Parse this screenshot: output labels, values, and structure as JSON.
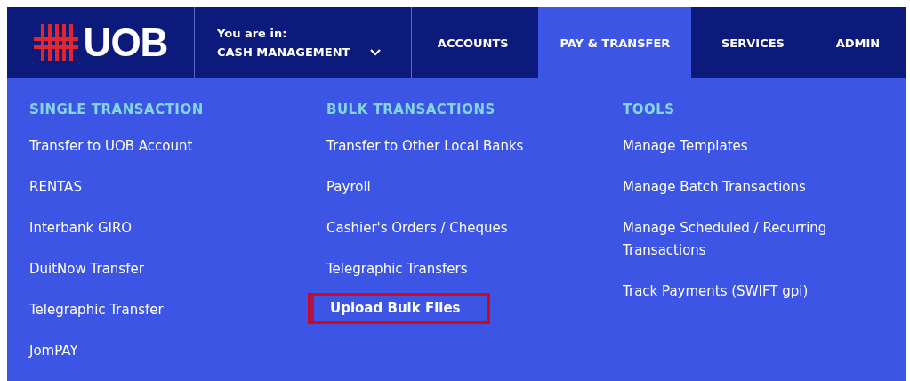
{
  "logo": {
    "text": "UOB"
  },
  "context": {
    "label": "You are in:",
    "value": "CASH MANAGEMENT"
  },
  "nav": [
    {
      "label": "ACCOUNTS",
      "selected": false
    },
    {
      "label": "PAY & TRANSFER",
      "selected": true
    },
    {
      "label": "SERVICES",
      "selected": false
    },
    {
      "label": "ADMIN",
      "selected": false
    }
  ],
  "menu_columns": [
    {
      "heading": "SINGLE TRANSACTION",
      "items": [
        {
          "label": "Transfer to UOB Account",
          "selected": false
        },
        {
          "label": "RENTAS",
          "selected": false
        },
        {
          "label": "Interbank GIRO",
          "selected": false
        },
        {
          "label": "DuitNow Transfer",
          "selected": false
        },
        {
          "label": "Telegraphic Transfer",
          "selected": false
        },
        {
          "label": "JomPAY",
          "selected": false
        }
      ]
    },
    {
      "heading": "BULK TRANSACTIONS",
      "items": [
        {
          "label": "Transfer to Other Local Banks",
          "selected": false
        },
        {
          "label": "Payroll",
          "selected": false
        },
        {
          "label": "Cashier's Orders / Cheques",
          "selected": false
        },
        {
          "label": "Telegraphic Transfers",
          "selected": false
        },
        {
          "label": "Upload Bulk Files",
          "selected": true
        }
      ]
    },
    {
      "heading": "TOOLS",
      "items": [
        {
          "label": "Manage Templates",
          "selected": false
        },
        {
          "label": "Manage Batch Transactions",
          "selected": false
        },
        {
          "label": "Manage Scheduled / Recurring Transactions",
          "selected": false
        },
        {
          "label": "Track Payments (SWIFT gpi)",
          "selected": false
        }
      ]
    }
  ]
}
